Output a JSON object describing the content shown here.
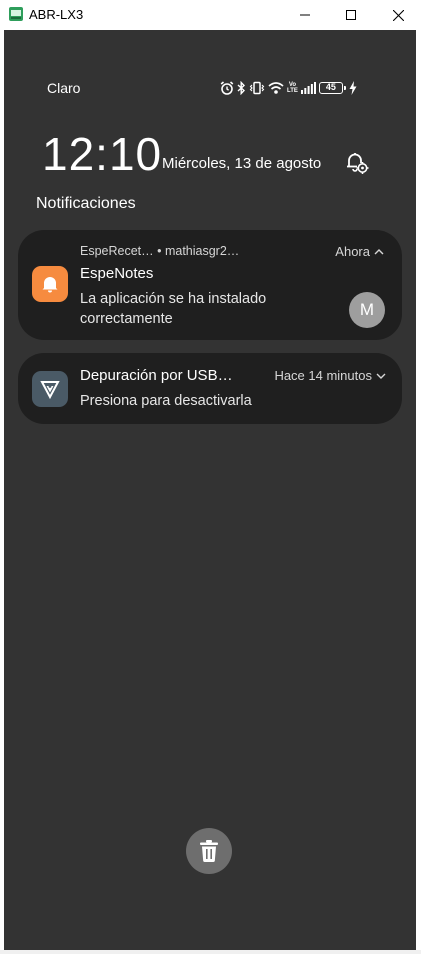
{
  "window": {
    "title": "ABR-LX3"
  },
  "status_bar": {
    "carrier": "Claro",
    "volte_top": "Vo",
    "volte_bottom": "LTE",
    "battery_level": "45"
  },
  "lock": {
    "time": "12:10",
    "date": "Miércoles, 13 de agosto"
  },
  "notifications": {
    "heading": "Notificaciones",
    "items": [
      {
        "source": "EspeRecet… • mathiasgr2…",
        "time": "Ahora",
        "title": "EspeNotes",
        "body": "La aplicación se ha instalado correctamente",
        "avatar": "M",
        "icon": "bell-icon",
        "icon_color": "#f68b3f"
      },
      {
        "title": "Depuración por USB…",
        "time": "Hace 14 minutos",
        "body": "Presiona para desactivarla",
        "icon": "usb-debug-icon",
        "icon_color": "#4a5a66"
      }
    ]
  },
  "colors": {
    "screen_bg": "#333333",
    "card_bg": "#1f1f1f",
    "trash_button_bg": "#6e6e6e"
  }
}
